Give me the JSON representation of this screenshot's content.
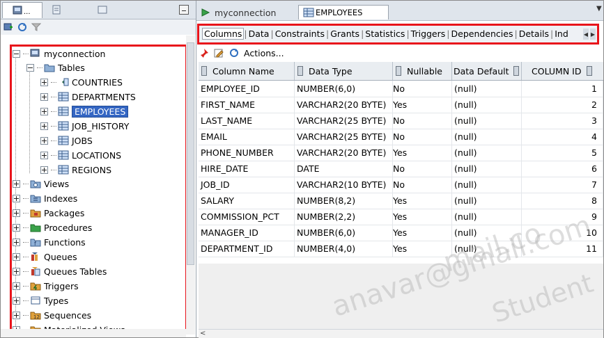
{
  "navigator": {
    "connection": "myconnection",
    "tables_label": "Tables",
    "tables": [
      "COUNTRIES",
      "DEPARTMENTS",
      "EMPLOYEES",
      "JOB_HISTORY",
      "JOBS",
      "LOCATIONS",
      "REGIONS"
    ],
    "selected_table": "EMPLOYEES",
    "nodes": [
      "Views",
      "Indexes",
      "Packages",
      "Procedures",
      "Functions",
      "Queues",
      "Queues Tables",
      "Triggers",
      "Types",
      "Sequences",
      "Materialized Views"
    ]
  },
  "editor_tabs": {
    "connection": "myconnection",
    "active": "EMPLOYEES"
  },
  "subtabs": [
    "Columns",
    "Data",
    "Constraints",
    "Grants",
    "Statistics",
    "Triggers",
    "Dependencies",
    "Details",
    "Ind"
  ],
  "actions_label": "Actions...",
  "grid": {
    "headers": [
      "Column Name",
      "Data Type",
      "Nullable",
      "Data Default",
      "COLUMN ID"
    ],
    "rows": [
      [
        "EMPLOYEE_ID",
        "NUMBER(6,0)",
        "No",
        "(null)",
        "1"
      ],
      [
        "FIRST_NAME",
        "VARCHAR2(20 BYTE)",
        "Yes",
        "(null)",
        "2"
      ],
      [
        "LAST_NAME",
        "VARCHAR2(25 BYTE)",
        "No",
        "(null)",
        "3"
      ],
      [
        "EMAIL",
        "VARCHAR2(25 BYTE)",
        "No",
        "(null)",
        "4"
      ],
      [
        "PHONE_NUMBER",
        "VARCHAR2(20 BYTE)",
        "Yes",
        "(null)",
        "5"
      ],
      [
        "HIRE_DATE",
        "DATE",
        "No",
        "(null)",
        "6"
      ],
      [
        "JOB_ID",
        "VARCHAR2(10 BYTE)",
        "No",
        "(null)",
        "7"
      ],
      [
        "SALARY",
        "NUMBER(8,2)",
        "Yes",
        "(null)",
        "8"
      ],
      [
        "COMMISSION_PCT",
        "NUMBER(2,2)",
        "Yes",
        "(null)",
        "9"
      ],
      [
        "MANAGER_ID",
        "NUMBER(6,0)",
        "Yes",
        "(null)",
        "10"
      ],
      [
        "DEPARTMENT_ID",
        "NUMBER(4,0)",
        "Yes",
        "(null)",
        "11"
      ]
    ]
  },
  "watermark": {
    "line1": "mail.co",
    "line2": "anavar@gmail.com",
    "line3": "Student"
  },
  "colors": {
    "highlight_border": "#e8141b",
    "selection": "#3466c3"
  }
}
